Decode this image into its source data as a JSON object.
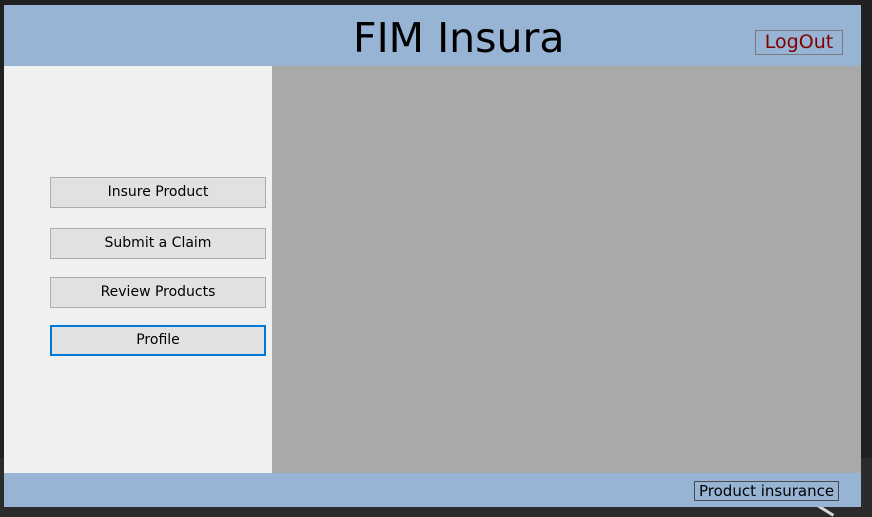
{
  "header": {
    "title": "FIM Insura",
    "logout_label": "LogOut"
  },
  "sidebar": {
    "items": [
      {
        "label": "Insure Product"
      },
      {
        "label": "Submit a Claim"
      },
      {
        "label": "Review Products"
      },
      {
        "label": "Profile",
        "focused": true
      }
    ]
  },
  "footer": {
    "label": "Product insurance"
  },
  "colors": {
    "header_bg": "#98b4d4",
    "content_bg": "#a9a9a9",
    "logout_text": "#800000",
    "focus_border": "#0078d7"
  }
}
